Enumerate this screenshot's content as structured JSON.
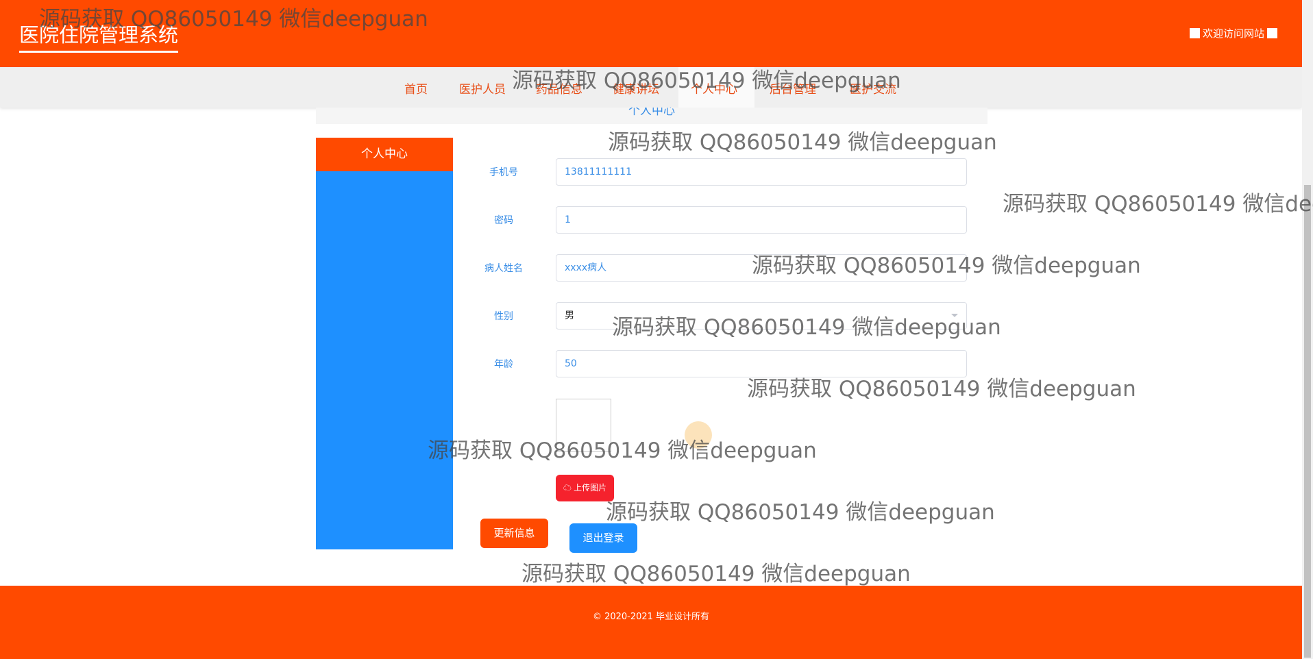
{
  "header": {
    "title": "医院住院管理系统",
    "welcome": "欢迎访问网站"
  },
  "nav": {
    "items": [
      "首页",
      "医护人员",
      "药品信息",
      "健康讲坛",
      "个人中心",
      "后台管理",
      "医护交流"
    ]
  },
  "breadcrumb": "个人中心",
  "sidebar": {
    "title": "个人中心"
  },
  "form": {
    "phone": {
      "label": "手机号",
      "value": "13811111111"
    },
    "password": {
      "label": "密码",
      "value": "1"
    },
    "name": {
      "label": "病人姓名",
      "value": "xxxx病人"
    },
    "gender": {
      "label": "性别",
      "value": "男"
    },
    "age": {
      "label": "年龄",
      "value": "50"
    },
    "upload_label": "上传图片",
    "update_label": "更新信息",
    "logout_label": "退出登录"
  },
  "footer": "© 2020-2021 毕业设计所有",
  "watermark": "源码获取 QQ86050149 微信deepguan"
}
